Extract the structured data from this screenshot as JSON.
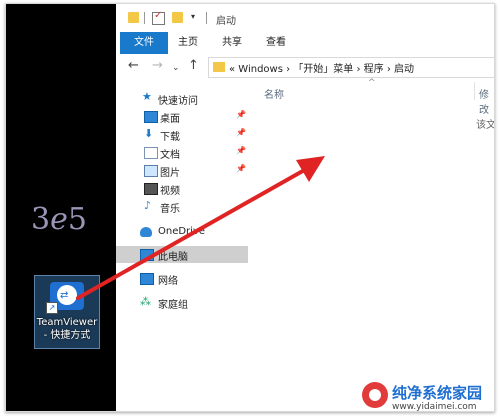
{
  "window": {
    "title": "启动"
  },
  "ribbon": {
    "tabs": [
      "文件",
      "主页",
      "共享",
      "查看"
    ]
  },
  "address_bar": {
    "path": "« Windows › 「开始」菜单 › 程序 › 启动"
  },
  "nav_pane": {
    "quick_access": "快速访问",
    "items": [
      {
        "label": "桌面",
        "icon": "desktop-icon",
        "pinned": true
      },
      {
        "label": "下载",
        "icon": "download-icon",
        "pinned": true
      },
      {
        "label": "文档",
        "icon": "document-icon",
        "pinned": true
      },
      {
        "label": "图片",
        "icon": "picture-icon",
        "pinned": true
      },
      {
        "label": "视频",
        "icon": "video-icon",
        "pinned": false
      },
      {
        "label": "音乐",
        "icon": "music-icon",
        "pinned": false
      }
    ],
    "onedrive": "OneDrive",
    "this_pc": "此电脑",
    "network": "网络",
    "homegroup": "家庭组"
  },
  "content": {
    "column_name": "名称",
    "column_modified": "修改",
    "empty_text": "该文"
  },
  "desktop": {
    "shortcut_label_line1": "TeamViewer",
    "shortcut_label_line2": "- 快捷方式"
  },
  "branding": {
    "site_name": "纯净系统家园",
    "site_url": "www.yidaimei.com"
  },
  "colors": {
    "accent": "#1979ca",
    "arrow": "#e02424"
  }
}
